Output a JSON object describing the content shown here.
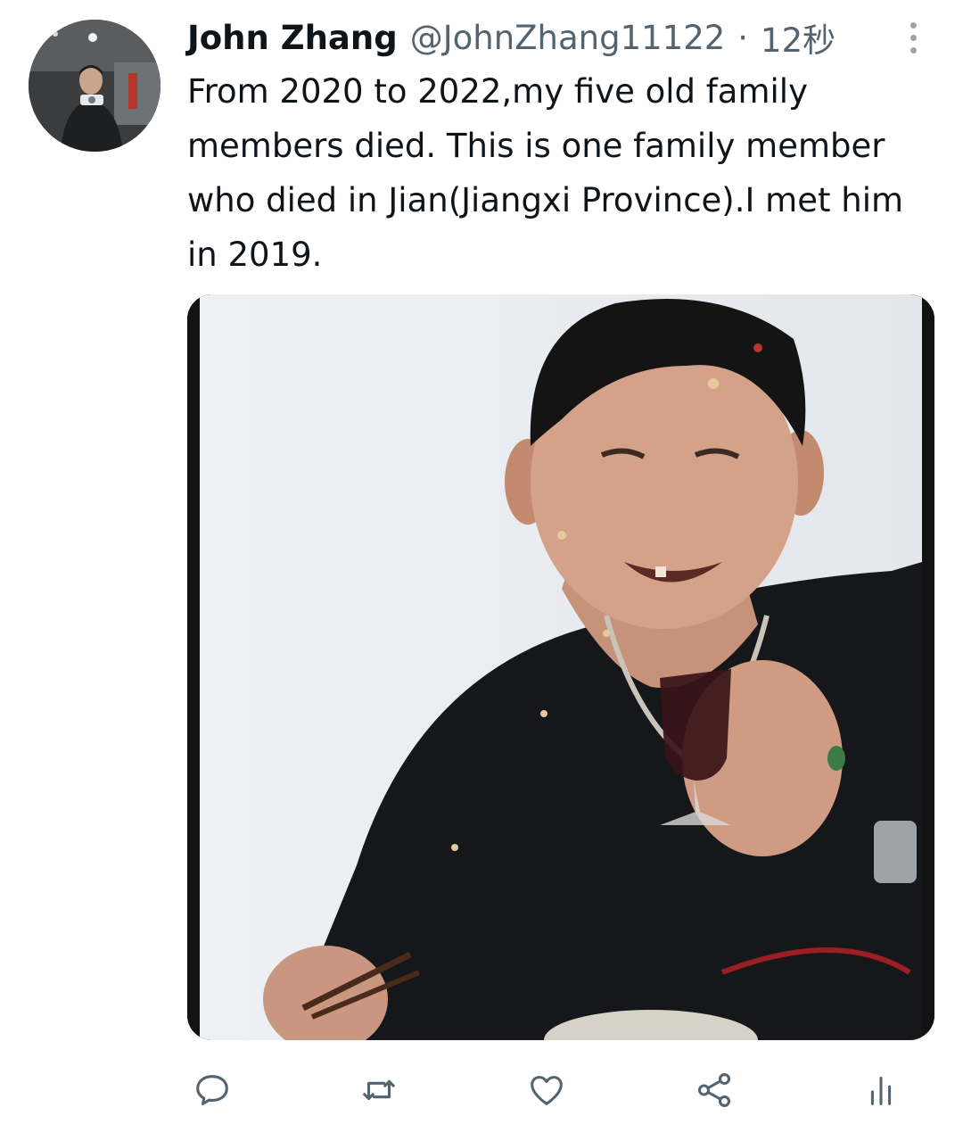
{
  "tweet": {
    "display_name": "John Zhang",
    "handle": "@JohnZhang11122",
    "separator": "·",
    "timestamp": "12秒",
    "text": "From 2020 to 2022,my five old family members died. This is one family member who died in Jian(Jiangxi Province).I met him in 2019."
  },
  "icons": {
    "more": "more-vertical-icon",
    "reply": "reply-icon",
    "retweet": "retweet-icon",
    "like": "like-icon",
    "share": "share-icon",
    "analytics": "analytics-icon"
  },
  "colors": {
    "text": "#0f1419",
    "secondary": "#536471",
    "icon": "#536471"
  }
}
